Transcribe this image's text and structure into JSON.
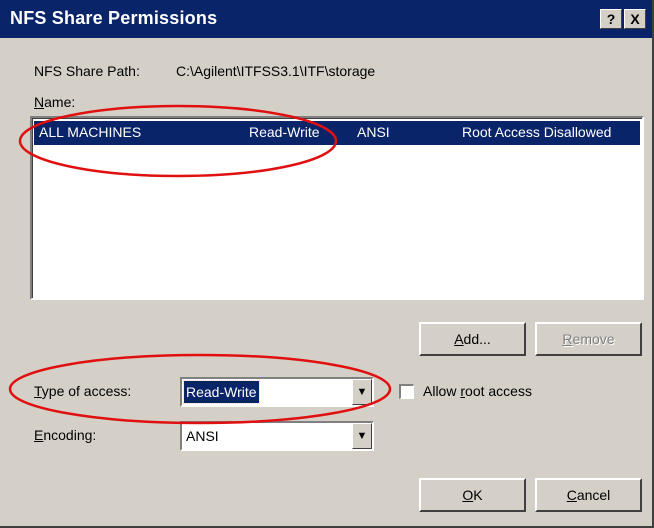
{
  "window": {
    "title": "NFS Share Permissions",
    "help_glyph": "?",
    "close_glyph": "X"
  },
  "share_path": {
    "label": "NFS Share Path:",
    "value": "C:\\Agilent\\ITFSS3.1\\ITF\\storage"
  },
  "name_list": {
    "label": "Name:",
    "rows": [
      {
        "machine": "ALL MACHINES",
        "access": "Read-Write",
        "encoding": "ANSI",
        "root": "Root Access Disallowed",
        "selected": true
      }
    ]
  },
  "buttons": {
    "add": "Add...",
    "remove": "Remove",
    "ok": "OK",
    "cancel": "Cancel"
  },
  "type_of_access": {
    "label": "Type of access:",
    "value": "Read-Write"
  },
  "allow_root": {
    "label": "Allow root access",
    "checked": false
  },
  "encoding": {
    "label": "Encoding:",
    "value": "ANSI"
  },
  "icons": {
    "dropdown": "chevron-down-icon",
    "help": "help-icon",
    "close": "close-icon"
  },
  "colors": {
    "titlebar": "#0a246a",
    "dialog": "#d4d0c8",
    "selection": "#0a246a",
    "annotation": "#e01010"
  }
}
